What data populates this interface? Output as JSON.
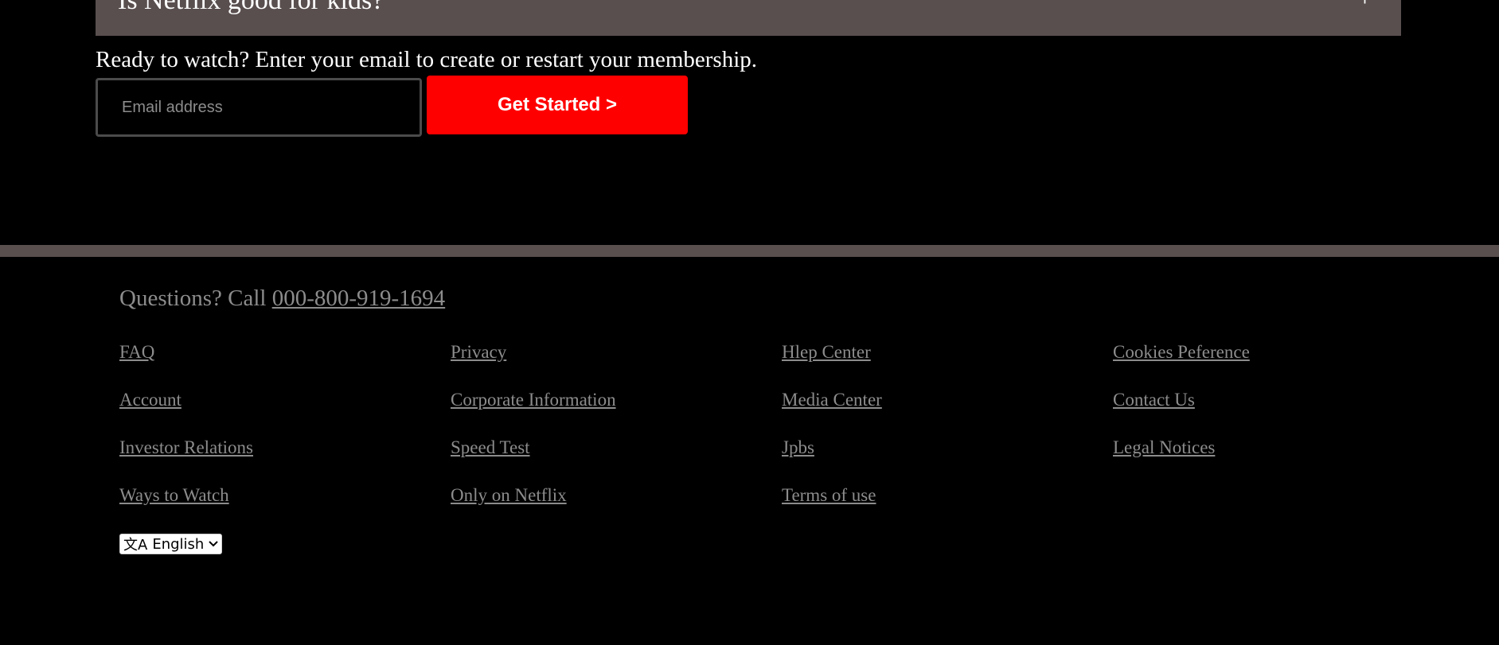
{
  "faq": {
    "question": "Is Netflix good for kids?",
    "toggle_symbol": "+"
  },
  "cta": {
    "text": "Ready to watch? Enter your email to create or restart your membership.",
    "email_placeholder": "Email address",
    "button_label": "Get Started >"
  },
  "footer": {
    "questions_prefix": "Questions? Call ",
    "phone": "000-800-919-1694",
    "links": [
      [
        "FAQ",
        "Account",
        "Investor Relations",
        "Ways to Watch"
      ],
      [
        "Privacy",
        "Corporate Information",
        "Speed Test",
        "Only on Netflix"
      ],
      [
        "Hlep Center",
        "Media Center",
        "Jpbs",
        "Terms of use"
      ],
      [
        "Cookies Peference",
        "Contact Us",
        "Legal Notices"
      ]
    ],
    "language": {
      "icon": "文A",
      "selected": "English"
    }
  },
  "colors": {
    "background": "#000000",
    "faq_bg": "#5a4f4f",
    "divider": "#5a4f4f",
    "accent": "#ff0000",
    "link_gray": "#8c8c8c"
  }
}
